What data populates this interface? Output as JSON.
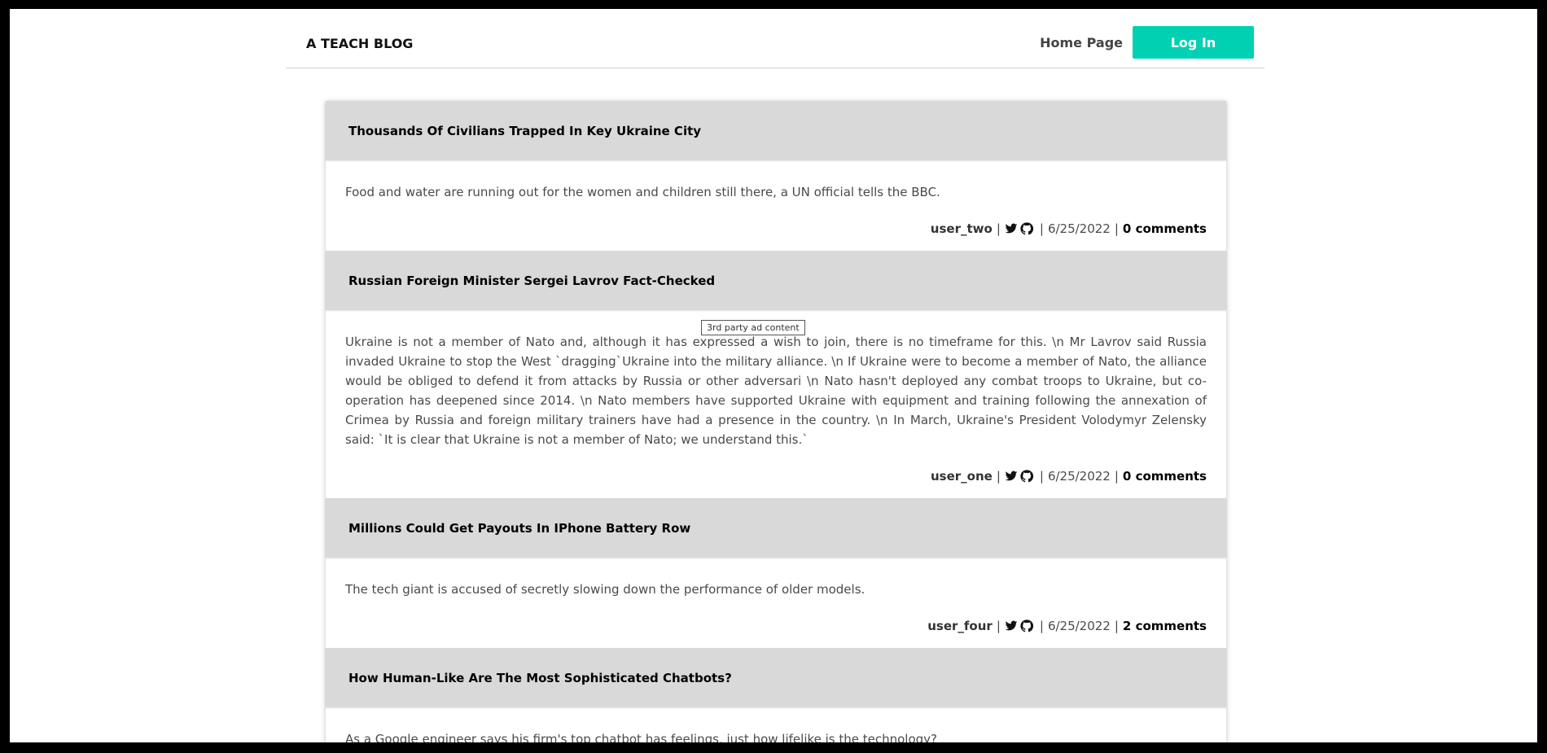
{
  "header": {
    "brand": "A TEACH BLOG",
    "home_link": "Home Page",
    "login_label": "Log In",
    "accent_color": "#00d1b2"
  },
  "tooltip": "3rd party ad content",
  "posts": [
    {
      "title": "Thousands Of Civilians Trapped In Key Ukraine City",
      "text": "Food and water are running out for the women and children still there, a UN official tells the BBC.",
      "user": "user_two",
      "date": "6/25/2022",
      "comments": "0 comments"
    },
    {
      "title": "Russian Foreign Minister Sergei Lavrov Fact-Checked",
      "text": "Ukraine is not a member of Nato and, although it has expressed a wish to join, there is no timeframe for this. \\n Mr Lavrov said Russia invaded Ukraine to stop the West `dragging`Ukraine into the military alliance. \\n If Ukraine were to become a member of Nato, the alliance would be obliged to defend it from attacks by Russia or other adversari \\n Nato hasn't deployed any combat troops to Ukraine, but co-operation has deepened since 2014. \\n Nato members have supported Ukraine with equipment and training following the annexation of Crimea by Russia and foreign military trainers have had a presence in the country. \\n In March, Ukraine's President Volodymyr Zelensky said: `It is clear that Ukraine is not a member of Nato; we understand this.`",
      "user": "user_one",
      "date": "6/25/2022",
      "comments": "0 comments"
    },
    {
      "title": "Millions Could Get Payouts In IPhone Battery Row",
      "text": "The tech giant is accused of secretly slowing down the performance of older models.",
      "user": "user_four",
      "date": "6/25/2022",
      "comments": "2 comments"
    },
    {
      "title": "How Human-Like Are The Most Sophisticated Chatbots?",
      "text": "As a Google engineer says his firm's top chatbot has feelings, just how lifelike is the technology?",
      "user": "",
      "date": "",
      "comments": ""
    }
  ],
  "meta_separator": "|",
  "icons": [
    "twitter-icon",
    "github-icon"
  ]
}
